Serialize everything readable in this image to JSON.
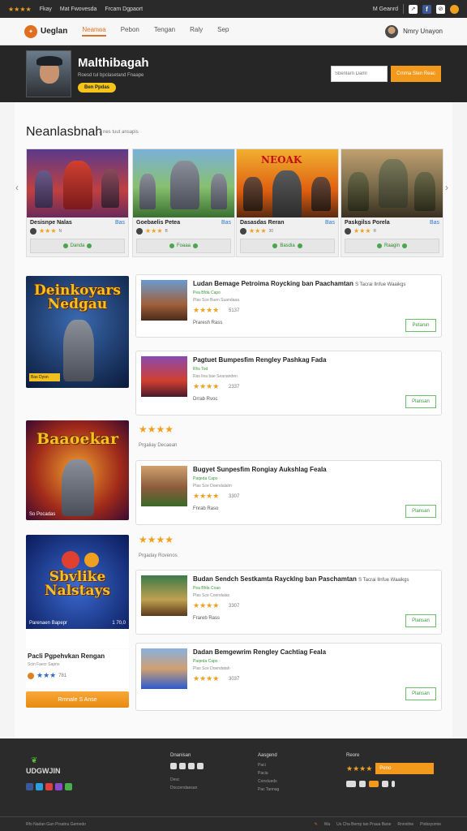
{
  "topstrip": {
    "links": [
      "Fkay",
      "Mat Fwovesda",
      "Frcam Dgpaort"
    ],
    "account": "M Geanrd"
  },
  "header": {
    "logo": "Ueglan",
    "nav": [
      "Neanwa",
      "Pebon",
      "Tengan",
      "Raly",
      "Sep"
    ],
    "user": "Nmry Unayon"
  },
  "profile": {
    "name": "Malthibagah",
    "sub": "Roesd tul bpclasetand Fnaape",
    "button": "Ben Ppdas",
    "search_placeholder": "Sbenlarn Daml",
    "search_button": "Crnma Sten Reac"
  },
  "section": {
    "title": "Neanlasbnah",
    "subtitle": "2 nes tuut ansapis"
  },
  "featured": [
    {
      "title": "Desisnpe Nalas",
      "tag": "Bas",
      "rating": 3,
      "count": "N",
      "button": "Danda"
    },
    {
      "title": "Goebaelis Petea",
      "tag": "Bas",
      "rating": 3,
      "count": "B",
      "button": "Foaaa"
    },
    {
      "title": "Dasasdas Reran",
      "tag": "Bas",
      "rating": 3,
      "count": "30",
      "button": "Basdia"
    },
    {
      "title": "Paskgilss Porela",
      "tag": "Bas",
      "rating": 3,
      "count": "R",
      "button": "Raagin"
    }
  ],
  "covers": [
    {
      "title": "Deinkoyars Nedgau",
      "foot": "Bas Dyon"
    },
    {
      "title": "Baaoekar",
      "foot": "So Pocadas"
    },
    {
      "title": "Sbvlike Nalstays",
      "foot": "Parenaen Bapepr"
    }
  ],
  "games": [
    {
      "title": "Ludan Bemage Petroima Roycking ban Paachamtan",
      "extra": "S Tacrai Ilnfue Waaikgs",
      "sub1": "Pea Bfda Capo",
      "sub2": "Plas Sce Buen Suandaaa",
      "count": "5137",
      "platform": "Praresh Rass",
      "button": "Petarun"
    },
    {
      "title": "Pagtuet Bumpesfim Rengley Pashkag Fada",
      "extra": "",
      "sub1": "Rhs Tod",
      "sub2": "Ras lina bae Seananden",
      "count": "2337",
      "platform": "Drrab Rvoc",
      "button": "Plansan"
    },
    {
      "title": "Bugyet Sunpesfim Rongiay Aukshlag Feala",
      "extra": "",
      "sub1": "Paqeda Capo",
      "sub2": "Plas Sce Doendalalm",
      "count": "3307",
      "platform": "Fnrab Raso",
      "button": "Plansan"
    },
    {
      "title": "Budan Sendch Sestkamta Raycklng ban Paschamtan",
      "extra": "S Tacrai Ilnfue Waaikgs",
      "sub1": "Pea Bfda Coao",
      "sub2": "Plas Sce Coendalas",
      "count": "3307",
      "platform": "Frareb Rass",
      "button": "Plansan"
    },
    {
      "title": "Dadan Bemgewrim Rengley Cachtiag Feala",
      "extra": "",
      "sub1": "Paqeda Capo",
      "sub2": "Plas Sce Doendatah",
      "count": "3037",
      "platform": "",
      "button": "Plansan"
    }
  ],
  "ratings": [
    {
      "stars": "★★★★",
      "sub": "Prgaliay Decaean"
    },
    {
      "stars": "★★★★",
      "sub": "Prgaday Rovenos"
    }
  ],
  "card": {
    "title": "Pacli Pgpehvkan Rengan",
    "sub": "Scin Faecr Sapns",
    "count": "781",
    "button": "Rmnale S Anse",
    "price": "1 70,0"
  },
  "footer": {
    "brand": "UDGWJIN",
    "col1": {
      "head": "Dnanisan",
      "items": [
        "Desc",
        "Doccendaesan"
      ]
    },
    "col2": {
      "head": "Aasgend",
      "items": [
        "Paci",
        "Pacia",
        "Conslueds",
        "Pac Tannag"
      ]
    },
    "col3": {
      "head": "Reore",
      "button": "Pono"
    },
    "bottom_left": "Rfo Nadan Gan Prsatnu Gemedo",
    "bottom_right": [
      "Wa",
      "Us Cha Bemp tan Praua Bane",
      "Rnnnilne",
      "Pinbsyomie"
    ]
  },
  "colors": {
    "accent": "#f39a1d",
    "dark": "#262626",
    "star": "#f0a020",
    "green": "#3a9a3a"
  }
}
